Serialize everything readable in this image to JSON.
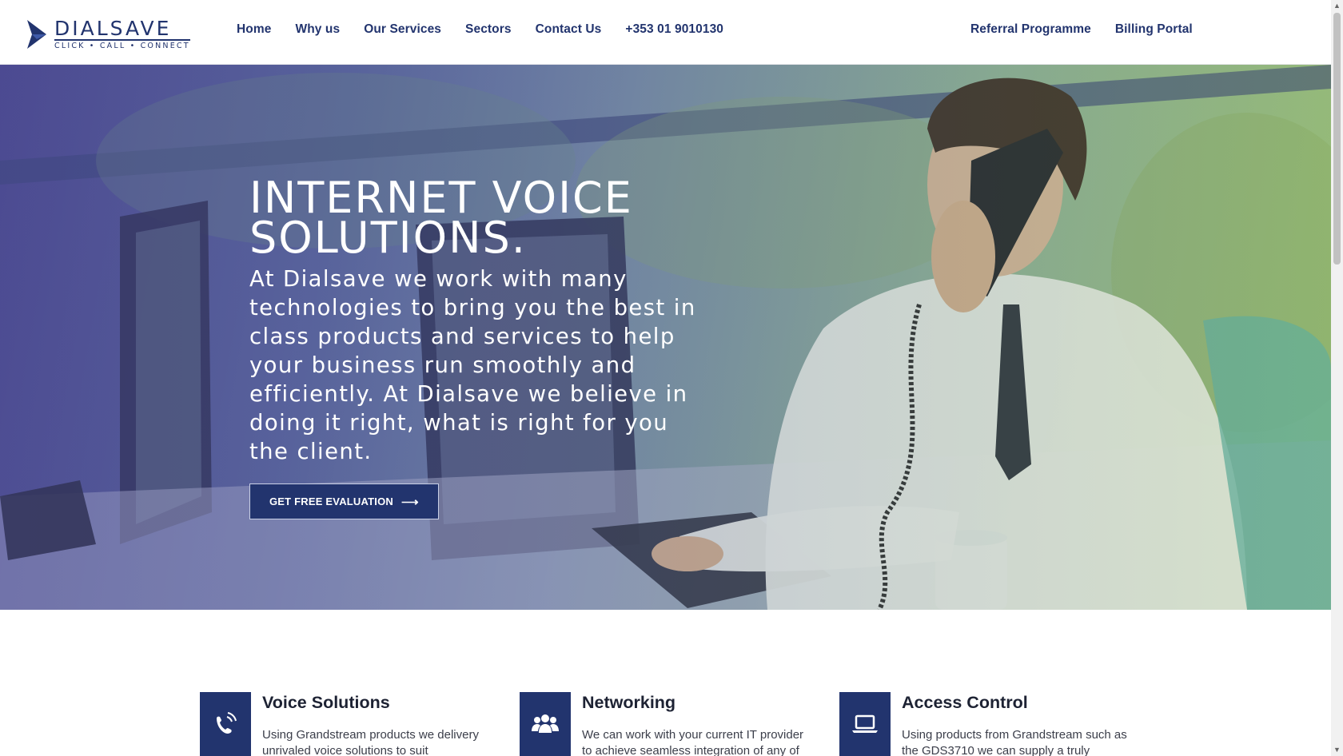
{
  "brand": {
    "name": "DIALSAVE",
    "tagline": "CLICK • CALL • CONNECT",
    "color": "#22346e"
  },
  "nav": {
    "items": [
      "Home",
      "Why us",
      "Our Services",
      "Sectors",
      "Contact Us",
      "+353 01 9010130"
    ],
    "right_items": [
      "Referral Programme",
      "Billing Portal"
    ]
  },
  "hero": {
    "title_line1": "INTERNET VOICE",
    "title_line2": "SOLUTIONS.",
    "text": "At Dialsave we work with many technologies to bring you the best in class products and services to help your business run smoothly and efficiently. At Dialsave we believe in doing it right, what is right for you the client.",
    "button_label": "GET FREE EVALUATION",
    "button_icon": "arrow-right-icon"
  },
  "features": [
    {
      "title": "Voice Solutions",
      "icon": "phone-icon",
      "text": "Using Grandstream products we delivery unrivaled voice solutions to suit"
    },
    {
      "title": "Networking",
      "icon": "users-icon",
      "text": "We can work with your current IT provider to achieve seamless integration of any of"
    },
    {
      "title": "Access Control",
      "icon": "laptop-icon",
      "text": "Using products from Grandstream such as the GDS3710 we can supply a truly"
    }
  ]
}
